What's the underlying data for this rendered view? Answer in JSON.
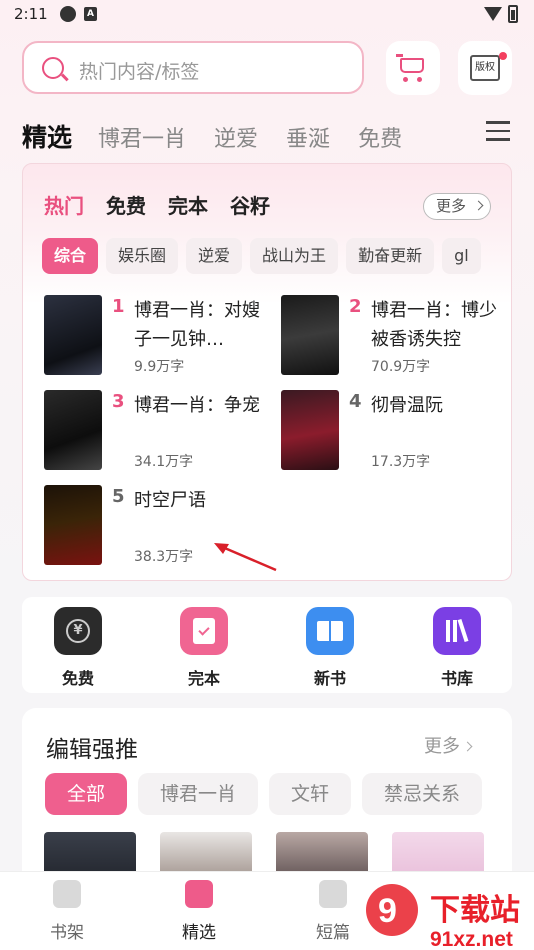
{
  "status": {
    "time": "2:11"
  },
  "search": {
    "placeholder": "热门内容/标签"
  },
  "header": {
    "copyright_label": "版权"
  },
  "tabs": [
    "精选",
    "博君一肖",
    "逆爱",
    "垂涎",
    "免费"
  ],
  "hot": {
    "subtabs": [
      "热门",
      "免费",
      "完本",
      "谷籽"
    ],
    "more_label": "更多",
    "chips": [
      "综合",
      "娱乐圈",
      "逆爱",
      "战山为王",
      "勤奋更新",
      "gl"
    ],
    "books": [
      {
        "rank": "1",
        "title": "博君一肖：对嫂子一见钟…",
        "words": "9.9万字",
        "rank_color": "#e9507f"
      },
      {
        "rank": "2",
        "title": "博君一肖：博少被香诱失控",
        "words": "70.9万字",
        "rank_color": "#e9507f"
      },
      {
        "rank": "3",
        "title": "博君一肖：争宠",
        "words": "34.1万字",
        "rank_color": "#e9507f"
      },
      {
        "rank": "4",
        "title": "彻骨温阮",
        "words": "17.3万字",
        "rank_color": "#666666"
      },
      {
        "rank": "5",
        "title": "时空尸语",
        "words": "38.3万字",
        "rank_color": "#666666"
      }
    ]
  },
  "quick_links": [
    {
      "label": "免费",
      "icon": "yuan-coin-icon",
      "color": "#2b2b2b"
    },
    {
      "label": "完本",
      "icon": "check-book-icon",
      "color": "#f06592"
    },
    {
      "label": "新书",
      "icon": "open-book-icon",
      "color": "#3d8ef0"
    },
    {
      "label": "书库",
      "icon": "library-icon",
      "color": "#7b3fe4"
    }
  ],
  "editor": {
    "title": "编辑强推",
    "more_label": "更多",
    "chips": [
      "全部",
      "博君一肖",
      "文轩",
      "禁忌关系"
    ]
  },
  "bottom_nav": [
    "书架",
    "精选",
    "短篇"
  ],
  "watermark": {
    "text": "下载站",
    "domain": "91xz.net"
  },
  "colors": {
    "accent": "#e9507f"
  }
}
